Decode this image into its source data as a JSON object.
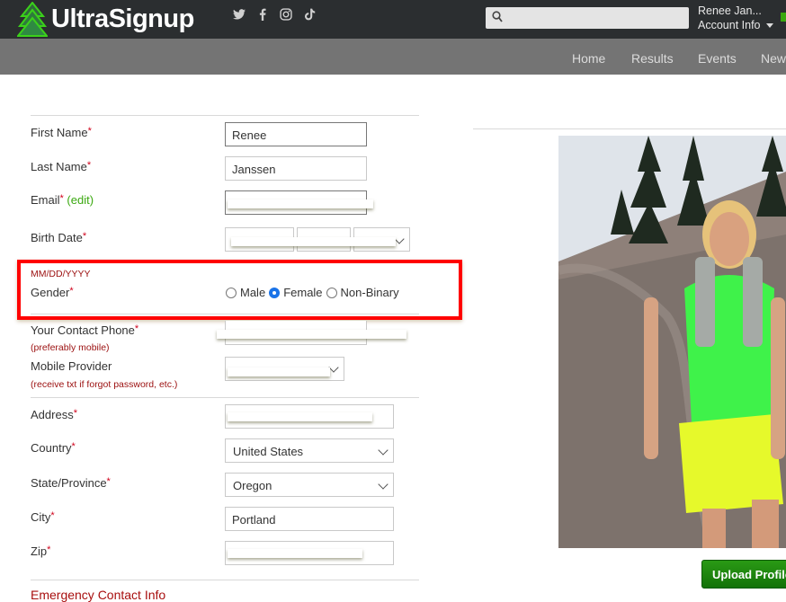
{
  "header": {
    "brand": "UltraSignup",
    "social": [
      {
        "name": "twitter-icon",
        "glyph": "🐦"
      },
      {
        "name": "facebook-icon",
        "glyph": "f"
      },
      {
        "name": "instagram-icon",
        "glyph": "◎"
      },
      {
        "name": "tiktok-icon",
        "glyph": "♪"
      }
    ],
    "search_placeholder": "",
    "user_name": "Renee Jan...",
    "account_label": "Account Info"
  },
  "nav": {
    "items": [
      "Home",
      "Results",
      "Events",
      "New"
    ]
  },
  "form": {
    "first_name": {
      "label": "First Name",
      "value": "Renee"
    },
    "last_name": {
      "label": "Last Name",
      "value": "Janssen"
    },
    "email": {
      "label": "Email",
      "edit": "(edit)",
      "value": ""
    },
    "birth_date": {
      "label": "Birth Date",
      "hint": "MM/DD/YYYY"
    },
    "gender": {
      "label": "Gender",
      "options": [
        "Male",
        "Female",
        "Non-Binary"
      ],
      "selected": "Female"
    },
    "phone": {
      "label": "Your Contact Phone",
      "hint": "(preferably mobile)",
      "value": ""
    },
    "mobile_provider": {
      "label": "Mobile Provider",
      "hint": "(receive txt if forgot password, etc.)",
      "value": ""
    },
    "address": {
      "label": "Address",
      "value": ""
    },
    "country": {
      "label": "Country",
      "value": "United States"
    },
    "state": {
      "label": "State/Province",
      "value": "Oregon"
    },
    "city": {
      "label": "City",
      "value": "Portland"
    },
    "zip": {
      "label": "Zip",
      "value": ""
    },
    "required_mark": "*",
    "emergency_heading": "Emergency Contact Info"
  },
  "profile": {
    "upload_label": "Upload Profile Photo"
  },
  "colors": {
    "brand_green": "#3aa80f",
    "highlight_red": "#ff0000",
    "hint_red": "#9b0f0f"
  }
}
